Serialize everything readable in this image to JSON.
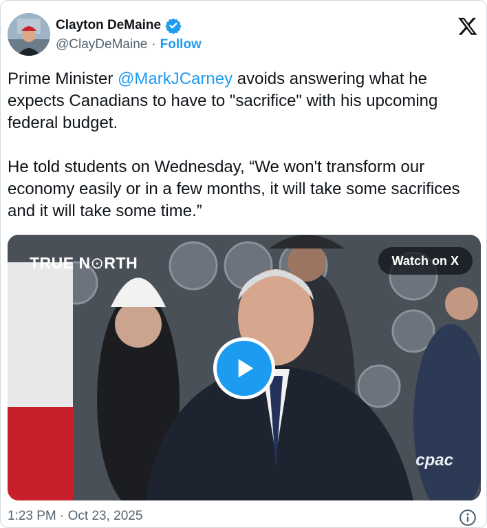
{
  "author": {
    "display_name": "Clayton DeMaine",
    "handle": "@ClayDeMaine",
    "separator": "·",
    "follow_label": "Follow",
    "avatar_icon": "avatar-photo",
    "verified_icon": "verified-badge-icon"
  },
  "platform_icon": "x-logo-icon",
  "tweet": {
    "para1_pre": "Prime Minister ",
    "para1_mention": "@MarkJCarney",
    "para1_post": " avoids answering what he expects Canadians to have to \"sacrifice\" with his upcoming federal budget.",
    "para2": "He told students on Wednesday, “We won't transform our economy easily or in a few months, it will take some sacrifices and it will take some time.”"
  },
  "media": {
    "brand_bold": "TRUE N",
    "brand_light": "RTH",
    "watch_label": "Watch on X",
    "play_icon": "play-icon",
    "watermark": "cpac"
  },
  "footer": {
    "timestamp": "1:23 PM · Oct 23, 2025",
    "info_icon": "info-icon"
  },
  "colors": {
    "accent": "#1d9bf0",
    "text": "#0f1419",
    "muted": "#536471",
    "border": "#cfd9de"
  }
}
